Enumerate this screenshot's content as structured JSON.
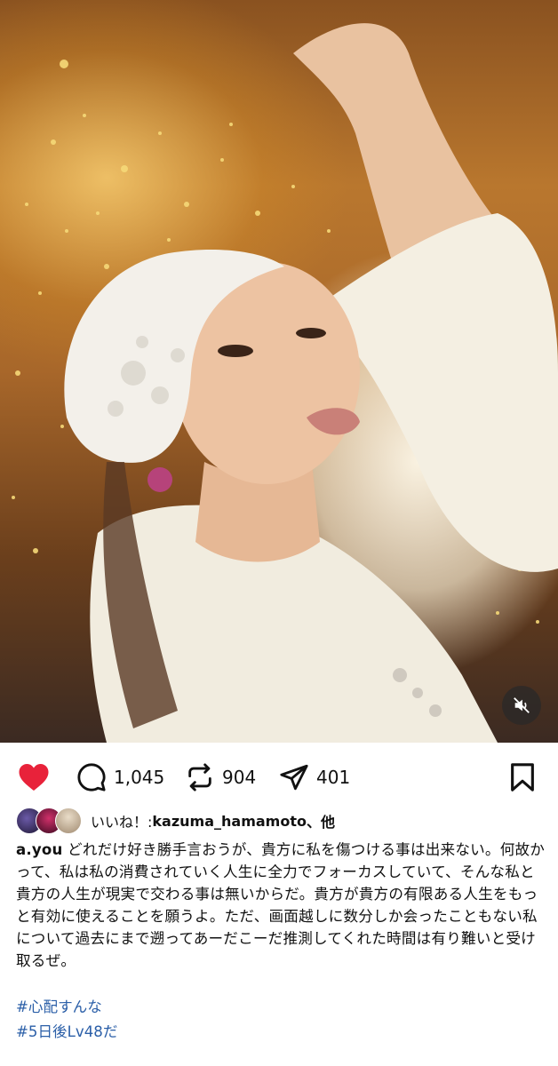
{
  "post": {
    "media": {
      "description_icon": "photo",
      "accent": "#b9772e",
      "mute_icon": "speaker-muted-icon"
    },
    "actions": {
      "like_icon": "heart-filled-icon",
      "like_color": "#e8223a",
      "comment_icon": "comment-icon",
      "comment_count": "1,045",
      "repost_icon": "repost-icon",
      "repost_count": "904",
      "share_icon": "send-icon",
      "share_count": "401",
      "save_icon": "bookmark-icon"
    },
    "likes": {
      "label": "いいね！: ",
      "user": "kazuma_hamamoto",
      "suffix": "、他"
    },
    "caption": {
      "username": "a.you",
      "text": " どれだけ好き勝手言おうが、貴方に私を傷つける事は出来ない。何故かって、私は私の消費されていく人生に全力でフォーカスしていて、そんな私と貴方の人生が現実で交わる事は無いからだ。貴方が貴方の有限ある人生をもっと有効に使えることを願うよ。ただ、画面越しに数分しか会ったこともない私について過去にまで遡ってあーだこーだ推測してくれた時間は有り難いと受け取るぜ。"
    },
    "hashtags": [
      "#心配すんな",
      "#5日後Lv48だ"
    ],
    "hashtag_color": "#2b5fa8"
  }
}
